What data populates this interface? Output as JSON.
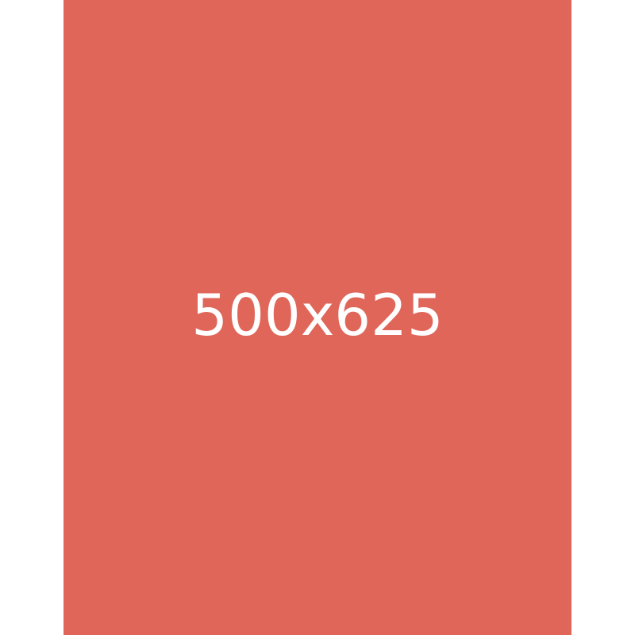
{
  "placeholder": {
    "label": "500x625",
    "background_color": "#E0665A",
    "text_color": "#FFFFFF"
  },
  "page": {
    "background_color": "#FFFFFF"
  }
}
